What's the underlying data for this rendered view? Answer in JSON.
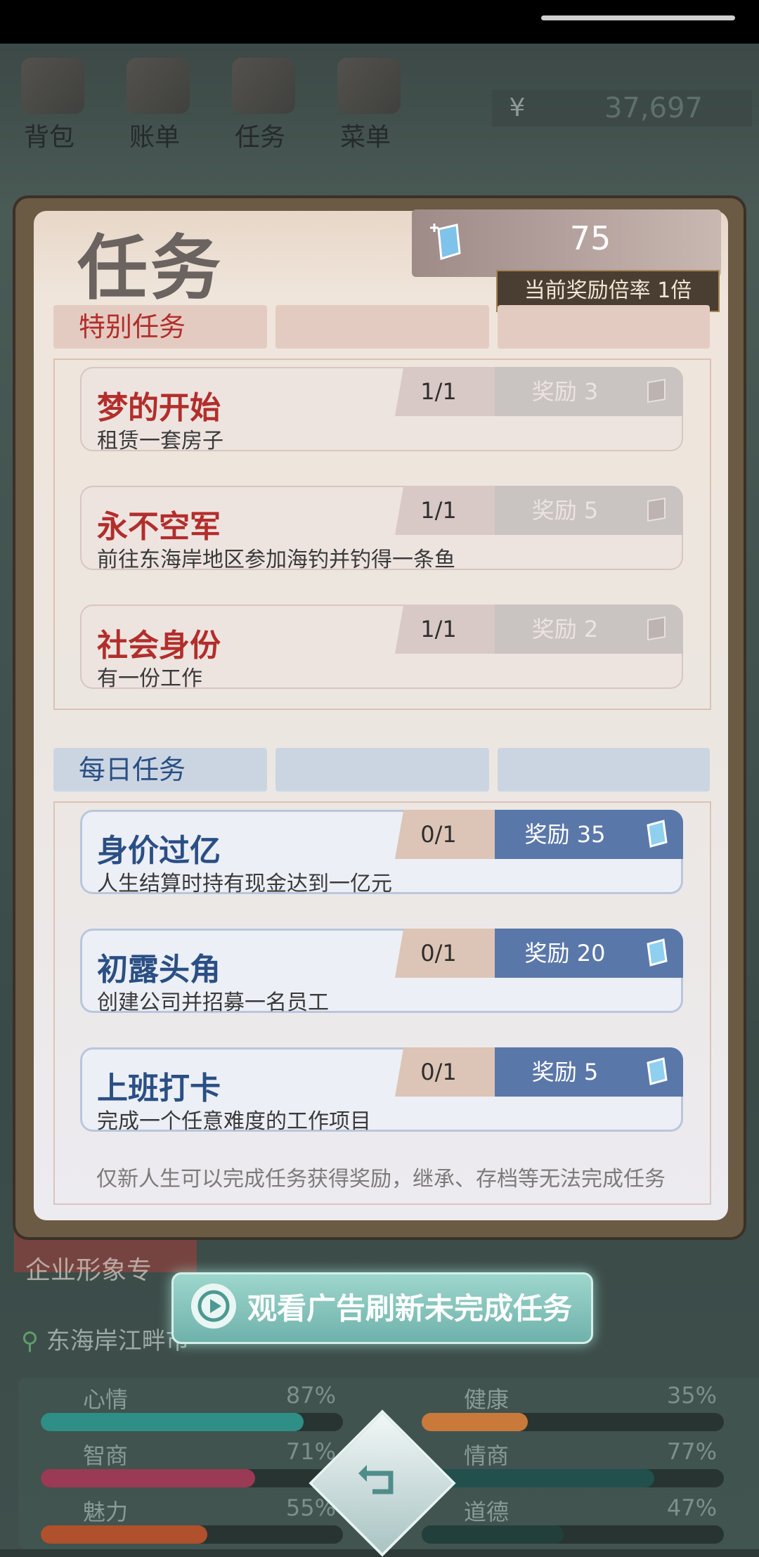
{
  "top_nav": [
    {
      "label": "背包",
      "icon": "bag-icon"
    },
    {
      "label": "账单",
      "icon": "bill-icon"
    },
    {
      "label": "任务",
      "icon": "task-icon"
    },
    {
      "label": "菜单",
      "icon": "menu-icon"
    }
  ],
  "money": {
    "symbol": "¥",
    "value": "37,697"
  },
  "panel": {
    "title": "任务",
    "gem_count": "75",
    "reward_rate": "当前奖励倍率 1倍",
    "special_label": "特别任务",
    "daily_label": "每日任务",
    "note": "仅新人生可以完成任务获得奖励，继承、存档等无法完成任务"
  },
  "special_tasks": [
    {
      "name": "梦的开始",
      "desc": "租赁一套房子",
      "progress": "1/1",
      "reward": "奖励 3"
    },
    {
      "name": "永不空军",
      "desc": "前往东海岸地区参加海钓并钓得一条鱼",
      "progress": "1/1",
      "reward": "奖励 5"
    },
    {
      "name": "社会身份",
      "desc": "有一份工作",
      "progress": "1/1",
      "reward": "奖励 2"
    }
  ],
  "daily_tasks": [
    {
      "name": "身价过亿",
      "desc": "人生结算时持有现金达到一亿元",
      "progress": "0/1",
      "reward": "奖励 35"
    },
    {
      "name": "初露头角",
      "desc": "创建公司并招募一名员工",
      "progress": "0/1",
      "reward": "奖励 20"
    },
    {
      "name": "上班打卡",
      "desc": "完成一个任意难度的工作项目",
      "progress": "0/1",
      "reward": "奖励 5"
    }
  ],
  "ad_button": "观看广告刷新未完成任务",
  "background": {
    "company_tag": "企业形象专",
    "location": "东海岸江畔市"
  },
  "stats": [
    {
      "name": "心情",
      "percent": "87%",
      "level": 0.87,
      "color": "#2f8e86"
    },
    {
      "name": "健康",
      "percent": "35%",
      "level": 0.35,
      "color": "#c97a3a"
    },
    {
      "name": "智商",
      "percent": "71%",
      "level": 0.71,
      "color": "#9b3a55"
    },
    {
      "name": "情商",
      "percent": "77%",
      "level": 0.77,
      "color": "#21504d"
    },
    {
      "name": "魅力",
      "percent": "55%",
      "level": 0.55,
      "color": "#b0502c"
    },
    {
      "name": "道德",
      "percent": "47%",
      "level": 0.47,
      "color": "#223f3c"
    }
  ],
  "colors": {
    "special_name": "#b22e2b",
    "daily_name": "#2a4f84",
    "daily_reward_bg": "#5a77aa",
    "done_reward_bg": "#c9c3c2"
  }
}
